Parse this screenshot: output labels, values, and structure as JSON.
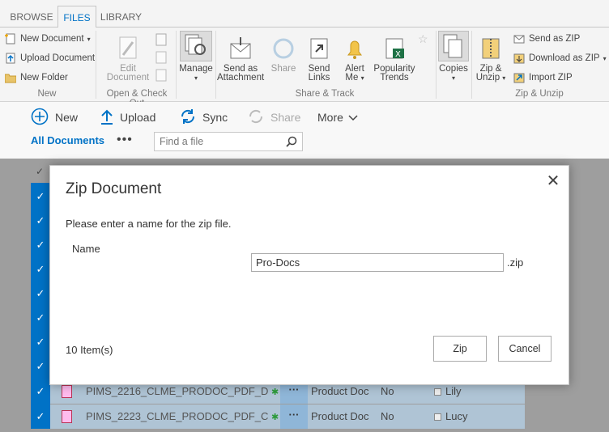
{
  "ribbon_tabs": [
    "BROWSE",
    "FILES",
    "LIBRARY"
  ],
  "ribbon": {
    "new_group": {
      "new_document": "New Document",
      "upload_document": "Upload Document",
      "new_folder": "New Folder",
      "label": "New"
    },
    "open_group": {
      "edit_document": [
        "Edit",
        "Document"
      ],
      "label": "Open & Check Out"
    },
    "manage": "Manage",
    "share_track": {
      "send_attachment": [
        "Send as",
        "Attachment"
      ],
      "share": "Share",
      "send_links": [
        "Send",
        "Links"
      ],
      "alert_me": [
        "Alert",
        "Me"
      ],
      "popularity": [
        "Popularity",
        "Trends"
      ],
      "label": "Share & Track"
    },
    "copies": "Copies",
    "zip_group": {
      "zip_unzip": [
        "Zip &",
        "Unzip"
      ],
      "send_as_zip": "Send as ZIP",
      "download_as_zip": "Download as ZIP",
      "import_zip": "Import ZIP",
      "label": "Zip & Unzip"
    }
  },
  "command_bar": {
    "new": "New",
    "upload": "Upload",
    "sync": "Sync",
    "share": "Share",
    "more": "More",
    "view": "All Documents",
    "search_placeholder": "Find a file"
  },
  "list_rows": [
    {
      "name": "PIMS_2216_CLME_PRODOC_PDF_D",
      "type": "Product Doc",
      "published": "No",
      "owner": "Lily"
    },
    {
      "name": "PIMS_2223_CLME_PRODOC_PDF_C",
      "type": "Product Doc",
      "published": "No",
      "owner": "Lucy"
    }
  ],
  "dialog": {
    "title": "Zip Document",
    "description": "Please enter a name for the zip file.",
    "name_label": "Name",
    "name_value": "Pro-Docs",
    "extension": ".zip",
    "item_count": "10 Item(s)",
    "zip_button": "Zip",
    "cancel_button": "Cancel"
  },
  "colors": {
    "accent": "#0072c6",
    "selected_row": "#afc4d5",
    "overlay": "#9e9e9e"
  }
}
